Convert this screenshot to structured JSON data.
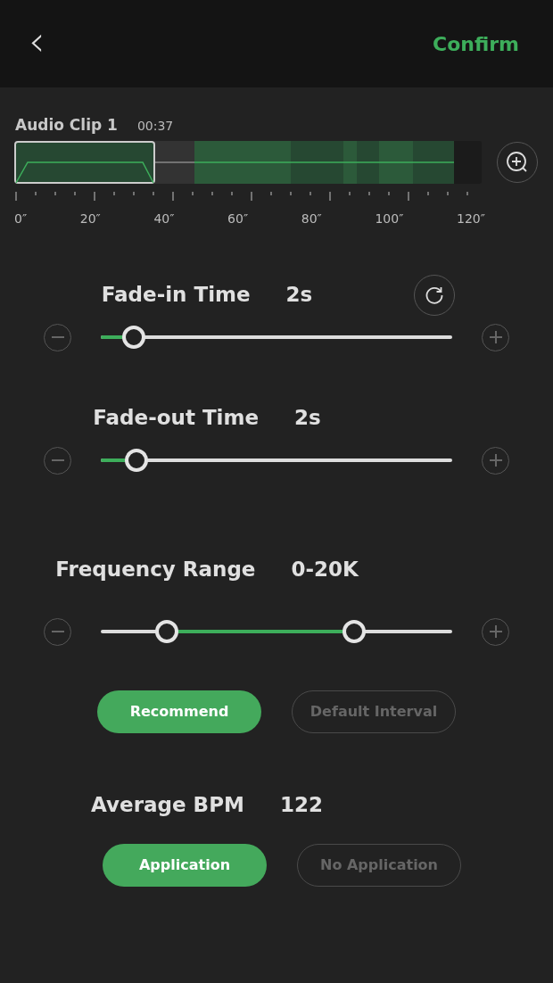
{
  "header": {
    "back_icon": "‹",
    "confirm": "Confirm"
  },
  "clip": {
    "name": "Audio Clip 1",
    "duration": "00:37"
  },
  "ruler_labels": [
    "0″",
    "20″",
    "40″",
    "60″",
    "80″",
    "100″",
    "120″"
  ],
  "settings": [
    {
      "kind": "slider",
      "title": "Fade-in Time",
      "value": "2s",
      "reset": true,
      "level": 0.094
    },
    {
      "kind": "slider",
      "title": "Fade-out Time",
      "value": "2s",
      "level": 0.102
    },
    {
      "kind": "range",
      "title": "Frequency Range",
      "value": "0-20K",
      "thumbs": [
        {
          "level": 0.188
        },
        {
          "level": 0.721
        }
      ],
      "options": [
        {
          "label": "Recommend",
          "selected": true
        },
        {
          "label": "Default Interval",
          "selected": false
        }
      ]
    },
    {
      "kind": "stat",
      "title": "Average BPM",
      "value": "122",
      "options": [
        {
          "label": "Application",
          "selected": true
        },
        {
          "label": "No Application",
          "selected": false
        }
      ]
    }
  ]
}
